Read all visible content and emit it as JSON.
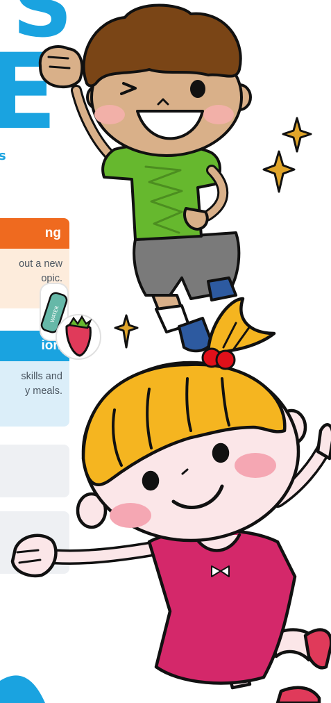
{
  "title": {
    "line1": "S",
    "line2": "E",
    "tagline": "s"
  },
  "cards": [
    {
      "heading": "ng",
      "lines": [
        "out a new",
        "opic."
      ]
    },
    {
      "heading": "ion",
      "lines": [
        "skills and",
        "y meals."
      ]
    }
  ],
  "sticker": {
    "bottle_text": "WATER"
  },
  "colors": {
    "brand_blue": "#1aa3e0",
    "brand_orange": "#ef6a1f",
    "boy_shirt": "#66b82e",
    "girl_dress": "#d4286a",
    "girl_hair": "#f5b520",
    "sparkle": "#e0a52a",
    "hair_tie": "#e0101a"
  },
  "icons": [
    "boy-illustration",
    "girl-illustration",
    "sparkle-icon",
    "water-bottle-sticker",
    "strawberry-sticker"
  ]
}
